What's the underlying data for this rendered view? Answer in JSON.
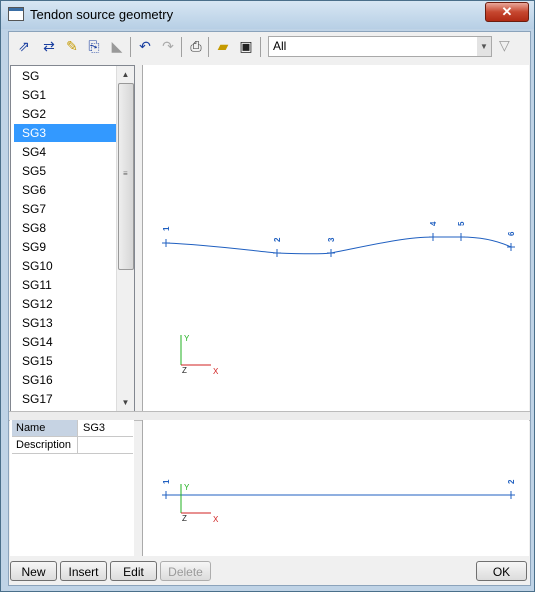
{
  "window": {
    "title": "Tendon source geometry",
    "close_label": "✕"
  },
  "toolbar": {
    "filter_value": "All",
    "icons": [
      "select-icon",
      "align-icon",
      "edit-icon",
      "copy-icon",
      "delete-icon",
      "undo-icon",
      "redo-icon",
      "print-icon",
      "open-folder-icon",
      "save-icon"
    ],
    "filter_icon": "funnel-icon"
  },
  "list": {
    "items": [
      "SG",
      "SG1",
      "SG2",
      "SG3",
      "SG4",
      "SG5",
      "SG6",
      "SG7",
      "SG8",
      "SG9",
      "SG10",
      "SG11",
      "SG12",
      "SG13",
      "SG14",
      "SG15",
      "SG16",
      "SG17"
    ],
    "selected": "SG3"
  },
  "properties": {
    "name_label": "Name",
    "name_value": "SG3",
    "description_label": "Description",
    "description_value": ""
  },
  "plan_view": {
    "point_labels": [
      "1",
      "2",
      "3",
      "4",
      "5",
      "6"
    ],
    "axis": {
      "y": "Y",
      "x": "X",
      "z": "Z"
    }
  },
  "side_view": {
    "point_labels": [
      "1",
      "2"
    ],
    "axis": {
      "y": "Y",
      "x": "X",
      "z": "Z"
    }
  },
  "buttons": {
    "new": "New",
    "insert": "Insert",
    "edit": "Edit",
    "delete": "Delete",
    "ok": "OK"
  },
  "colors": {
    "curve": "#1f5fc0",
    "selection": "#3399ff",
    "axis_x": "#d02020",
    "axis_y": "#20b020"
  }
}
